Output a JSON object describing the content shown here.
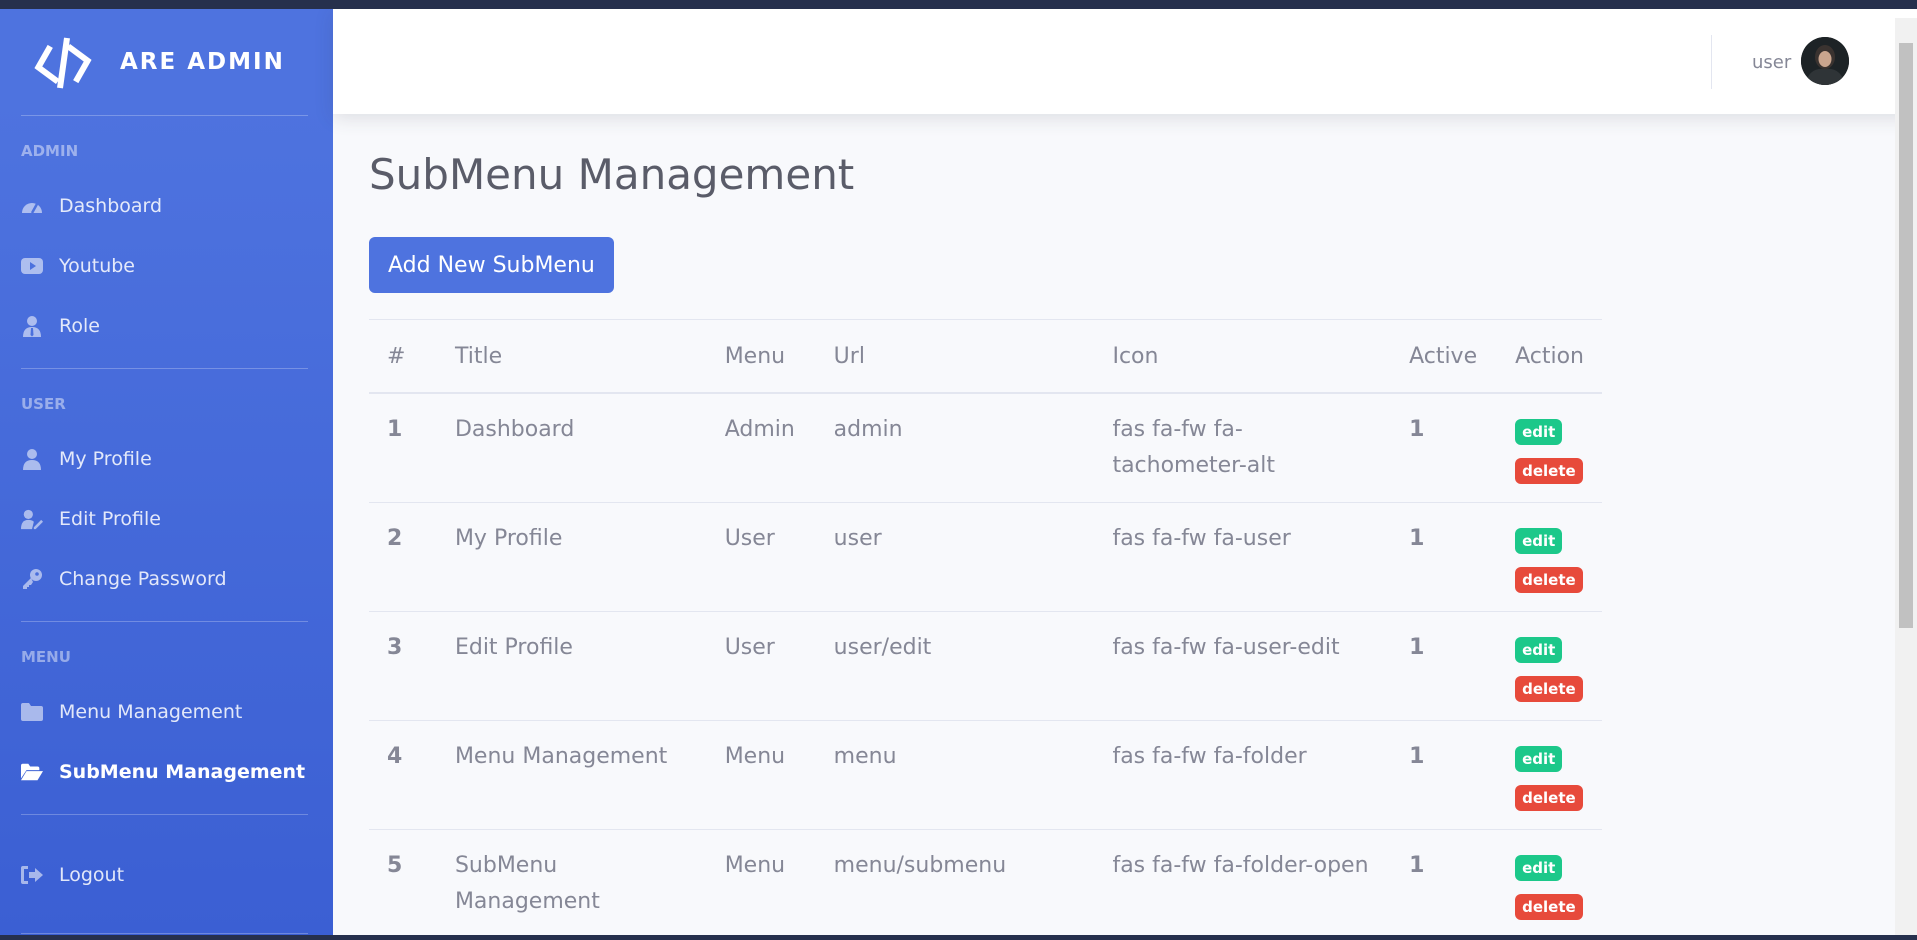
{
  "brand": {
    "name": "ARE ADMIN",
    "icon": "code-icon"
  },
  "sidebar": {
    "sections": [
      {
        "heading": "ADMIN",
        "items": [
          {
            "label": "Dashboard",
            "icon": "tachometer-icon"
          },
          {
            "label": "Youtube",
            "icon": "youtube-icon"
          },
          {
            "label": "Role",
            "icon": "user-tie-icon"
          }
        ]
      },
      {
        "heading": "USER",
        "items": [
          {
            "label": "My Profile",
            "icon": "user-icon"
          },
          {
            "label": "Edit Profile",
            "icon": "user-edit-icon"
          },
          {
            "label": "Change Password",
            "icon": "key-icon"
          }
        ]
      },
      {
        "heading": "MENU",
        "items": [
          {
            "label": "Menu Management",
            "icon": "folder-icon"
          },
          {
            "label": "SubMenu Management",
            "icon": "folder-open-icon",
            "active": true
          }
        ]
      }
    ],
    "logout": {
      "label": "Logout",
      "icon": "sign-out-icon"
    }
  },
  "topbar": {
    "username": "user"
  },
  "page": {
    "title": "SubMenu Management",
    "add_button": "Add New SubMenu"
  },
  "table": {
    "columns": [
      "#",
      "Title",
      "Menu",
      "Url",
      "Icon",
      "Active",
      "Action"
    ],
    "rows": [
      {
        "num": "1",
        "title": "Dashboard",
        "menu": "Admin",
        "url": "admin",
        "icon": "fas fa-fw fa-tachometer-alt",
        "active": "1"
      },
      {
        "num": "2",
        "title": "My Profile",
        "menu": "User",
        "url": "user",
        "icon": "fas fa-fw fa-user",
        "active": "1"
      },
      {
        "num": "3",
        "title": "Edit Profile",
        "menu": "User",
        "url": "user/edit",
        "icon": "fas fa-fw fa-user-edit",
        "active": "1"
      },
      {
        "num": "4",
        "title": "Menu Management",
        "menu": "Menu",
        "url": "menu",
        "icon": "fas fa-fw fa-folder",
        "active": "1"
      },
      {
        "num": "5",
        "title": "SubMenu Management",
        "menu": "Menu",
        "url": "menu/submenu",
        "icon": "fas fa-fw fa-folder-open",
        "active": "1"
      }
    ],
    "edit_label": "edit",
    "delete_label": "delete"
  },
  "colors": {
    "primary": "#4e73df",
    "success": "#1cc88a",
    "danger": "#e74a3b",
    "text": "#858796"
  }
}
